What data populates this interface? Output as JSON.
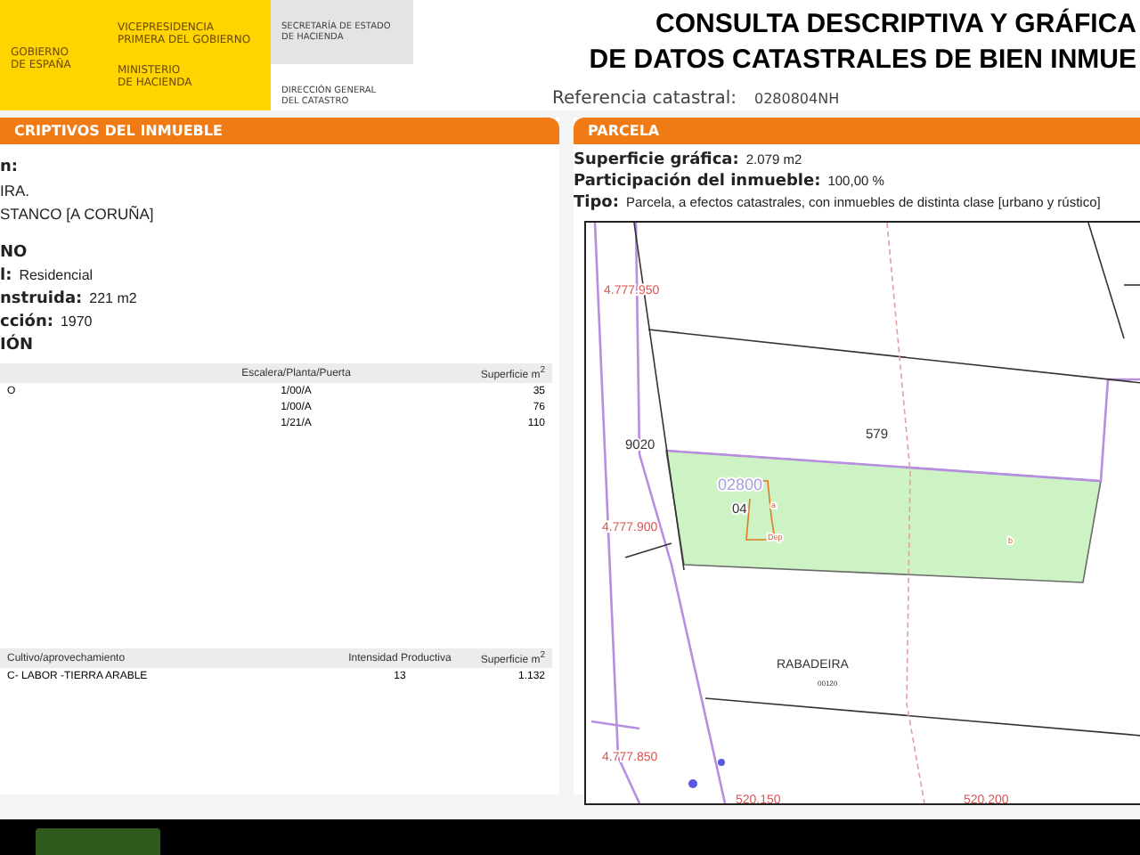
{
  "header": {
    "logo": {
      "country": [
        "GOBIERNO",
        "DE ESPAÑA"
      ],
      "vice": [
        "VICEPRESIDENCIA",
        "PRIMERA DEL GOBIERNO"
      ],
      "ministry": [
        "MINISTERIO",
        "DE HACIENDA"
      ],
      "secretary": [
        "SECRETARÍA DE ESTADO",
        "DE HACIENDA"
      ],
      "direction": [
        "DIRECCIÓN GENERAL",
        "DEL CATASTRO"
      ]
    },
    "title": [
      "CONSULTA DESCRIPTIVA Y GRÁFICA",
      "DE DATOS CATASTRALES DE BIEN INMUE"
    ],
    "reference_label": "Referencia catastral:",
    "reference_value": "0280804NH"
  },
  "left_panel": {
    "title": "CRIPTIVOS DEL INMUEBLE",
    "fields": [
      {
        "label": "n:"
      },
      {
        "value": "IRA."
      },
      {
        "value": "STANCO [A CORUÑA]"
      },
      {
        "label": "NO"
      },
      {
        "label": "l:",
        "value": "Residencial"
      },
      {
        "label": "nstruida:",
        "value": "221 m2"
      },
      {
        "label": "cción:",
        "value": "1970"
      },
      {
        "label": "IÓN"
      }
    ],
    "table": {
      "columns": [
        "",
        "Escalera/Planta/Puerta",
        "Superficie m$^{2}$"
      ],
      "rows": [
        [
          "O",
          "1/00/A",
          "35"
        ],
        [
          "",
          "1/00/A",
          "76"
        ],
        [
          "",
          "1/21/A",
          "110"
        ]
      ]
    },
    "crops": {
      "columns": [
        "Cultivo/aprovechamiento",
        "Intensidad Productiva",
        "Superficie m$^{2}$"
      ],
      "rows": [
        [
          "C- LABOR -TIERRA ARABLE",
          "13",
          "1.132"
        ]
      ]
    }
  },
  "right_panel": {
    "title": "PARCELA",
    "fields": [
      {
        "label": "Superficie gráfica:",
        "value": "2.079 m2"
      },
      {
        "label": "Participación del inmueble:",
        "value": "100,00 %"
      },
      {
        "label": "Tipo:",
        "value": "Parcela, a efectos catastrales, con inmuebles de distinta clase [urbano y rústico]"
      }
    ],
    "map": {
      "labels": [
        {
          "kind": "coord",
          "text": "4.777.950"
        },
        {
          "kind": "parcel",
          "text": "9020"
        },
        {
          "kind": "parcel",
          "text": "579"
        },
        {
          "kind": "ref",
          "text": "02800"
        },
        {
          "kind": "parcel",
          "text": "04"
        },
        {
          "kind": "sub",
          "text": "a"
        },
        {
          "kind": "sub",
          "text": "Dep"
        },
        {
          "kind": "sub",
          "text": "b"
        },
        {
          "kind": "coord",
          "text": "4.777.900"
        },
        {
          "kind": "place",
          "text": "RABADEIRA"
        },
        {
          "kind": "small",
          "text": "00120"
        },
        {
          "kind": "coord",
          "text": "4.777.850"
        },
        {
          "kind": "coord",
          "text": "520.150"
        },
        {
          "kind": "coord",
          "text": "520.200"
        }
      ]
    }
  }
}
